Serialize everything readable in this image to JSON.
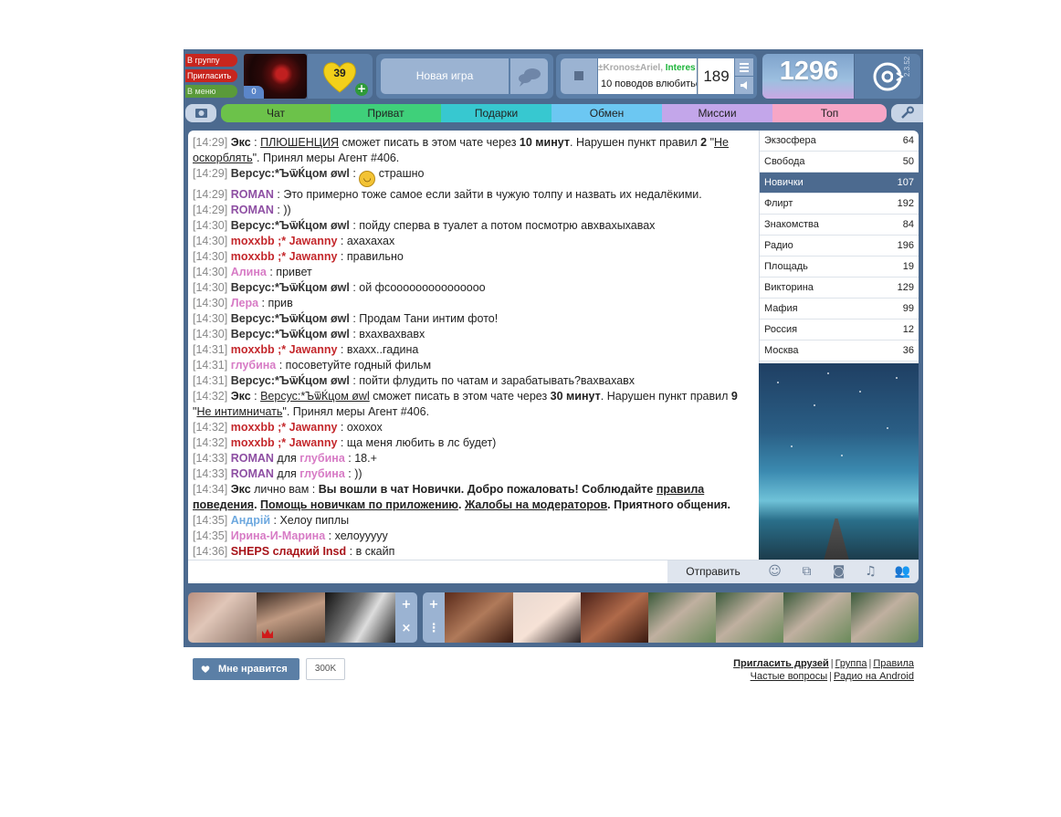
{
  "sidebar_buttons": {
    "group": "В группу",
    "invite": "Пригласить",
    "menu": "В меню"
  },
  "avatar_badge": "0",
  "hearts": "39",
  "new_game": "Новая игра",
  "radio": {
    "ticker_name_a": "±Kronos±Ariel",
    "ticker_sep": ",",
    "ticker_name_b": "Interes",
    "ticker_text": "10 поводов влюбиться",
    "listeners": "189"
  },
  "score": "1296",
  "version": "2.3.52",
  "tabs": [
    {
      "label": "Чат",
      "color": "#6cc24a"
    },
    {
      "label": "Приват",
      "color": "#3fd07a"
    },
    {
      "label": "Подарки",
      "color": "#37c8d0"
    },
    {
      "label": "Обмен",
      "color": "#6cc7f2"
    },
    {
      "label": "Миссии",
      "color": "#c3a6ea"
    },
    {
      "label": "Топ",
      "color": "#f7a6c6"
    }
  ],
  "messages": {
    "m1": {
      "time": "[14:29]",
      "user": "Экс",
      "sep": " : ",
      "a": "ПЛЮШЕНЦИЯ",
      "b": " сможет писать в этом чате через ",
      "c": "10 минут",
      "d": ". Нарушен пункт правил ",
      "e": "2",
      "f": " \"",
      "g": "Не оскорблять",
      "h": "\". Принял меры Агент #406."
    },
    "m2": {
      "time": "[14:29]",
      "user": "Версус:*ЪѿЌцом øwl",
      "sep": " : ",
      "text": " страшно"
    },
    "m3": {
      "time": "[14:29]",
      "user": "ROMAN",
      "sep": " : ",
      "text": "Это примерно тоже самое если зайти в чужую толпу и назвать их недалёкими."
    },
    "m4": {
      "time": "[14:29]",
      "user": "ROMAN",
      "sep": " : ",
      "text": "))"
    },
    "m5": {
      "time": "[14:30]",
      "user": "Версус:*ЪѿЌцом øwl",
      "sep": " : ",
      "text": "пойду сперва в туалет а потом посмотрю авхвахыхавах"
    },
    "m6": {
      "time": "[14:30]",
      "user": "moxxbb ;* Jawanny",
      "sep": " : ",
      "text": "ахахахах"
    },
    "m7": {
      "time": "[14:30]",
      "user": "moxxbb ;* Jawanny",
      "sep": " : ",
      "text": "правильно"
    },
    "m8": {
      "time": "[14:30]",
      "user": "Алина",
      "sep": " : ",
      "text": "привет"
    },
    "m9": {
      "time": "[14:30]",
      "user": "Версус:*ЪѿЌцом øwl",
      "sep": " : ",
      "text": "ой фсооооооооооооооо"
    },
    "m10": {
      "time": "[14:30]",
      "user": "Лера",
      "sep": " : ",
      "text": "прив"
    },
    "m11": {
      "time": "[14:30]",
      "user": "Версус:*ЪѿЌцом øwl",
      "sep": " : ",
      "text": "Продам Тани интим фото!"
    },
    "m12": {
      "time": "[14:30]",
      "user": "Версус:*ЪѿЌцом øwl",
      "sep": " : ",
      "text": "вхахвахвавх"
    },
    "m13": {
      "time": "[14:31]",
      "user": "moxxbb ;* Jawanny",
      "sep": " : ",
      "text": "вхахх..гадина"
    },
    "m14": {
      "time": "[14:31]",
      "user": "глубина",
      "sep": " : ",
      "text": "посоветуйте годный фильм"
    },
    "m15": {
      "time": "[14:31]",
      "user": "Версус:*ЪѿЌцом øwl",
      "sep": " : ",
      "text": "пойти флудить по чатам и зарабатывать?вахвахавх"
    },
    "m16": {
      "time": "[14:32]",
      "user": "Экс",
      "sep": " : ",
      "a": "Версус:*ЪѿЌцом øwl",
      "b": " сможет писать в этом чате через ",
      "c": "30 минут",
      "d": ". Нарушен пункт правил ",
      "e": "9",
      "f": " \"",
      "g": "Не интимничать",
      "h": "\". Принял меры Агент #406."
    },
    "m17": {
      "time": "[14:32]",
      "user": "moxxbb ;* Jawanny",
      "sep": " : ",
      "text": "охохох"
    },
    "m18": {
      "time": "[14:32]",
      "user": "moxxbb ;* Jawanny",
      "sep": " : ",
      "text": "ща меня любить в лс будет)"
    },
    "m19": {
      "time": "[14:33]",
      "user": "ROMAN",
      "for": " для ",
      "to": "глубина",
      "sep": " : ",
      "text": "18.+"
    },
    "m20": {
      "time": "[14:33]",
      "user": "ROMAN",
      "for": " для ",
      "to": "глубина",
      "sep": " : ",
      "text": "))"
    },
    "m21": {
      "time": "[14:34]",
      "user": "Экс",
      "private": " лично вам : ",
      "a": "Вы вошли в чат Новички. Добро пожаловать! Соблюдайте ",
      "b": "правила поведения",
      "c": ". ",
      "d": "Помощь новичкам по приложению",
      "e": ". ",
      "f": "Жалобы на модераторов",
      "g": ". Приятного общения."
    },
    "m22": {
      "time": "[14:35]",
      "user": "Андрій",
      "sep": " : ",
      "text": "Хелоу пиплы"
    },
    "m23": {
      "time": "[14:35]",
      "user": "Ирина-И-Марина",
      "sep": " : ",
      "text": "хелоуyyyy"
    },
    "m24": {
      "time": "[14:36]",
      "user": "SHEPS сладкий Insd",
      "sep": " : ",
      "text": "в скайп"
    }
  },
  "send_button": "Отправить",
  "rooms": [
    {
      "name": "Экзосфера",
      "count": "64"
    },
    {
      "name": "Свобода",
      "count": "50"
    },
    {
      "name": "Новички",
      "count": "107"
    },
    {
      "name": "Флирт",
      "count": "192"
    },
    {
      "name": "Знакомства",
      "count": "84"
    },
    {
      "name": "Радио",
      "count": "196"
    },
    {
      "name": "Площадь",
      "count": "19"
    },
    {
      "name": "Викторина",
      "count": "129"
    },
    {
      "name": "Мафия",
      "count": "99"
    },
    {
      "name": "Россия",
      "count": "12"
    },
    {
      "name": "Москва",
      "count": "36"
    }
  ],
  "footer": {
    "like": "Мне нравится",
    "like_count": "300K",
    "invite_friends": "Пригласить друзей",
    "group": "Группа",
    "rules": "Правила",
    "faq": "Частые вопросы",
    "android": "Радио на Android",
    "sep": "|"
  }
}
